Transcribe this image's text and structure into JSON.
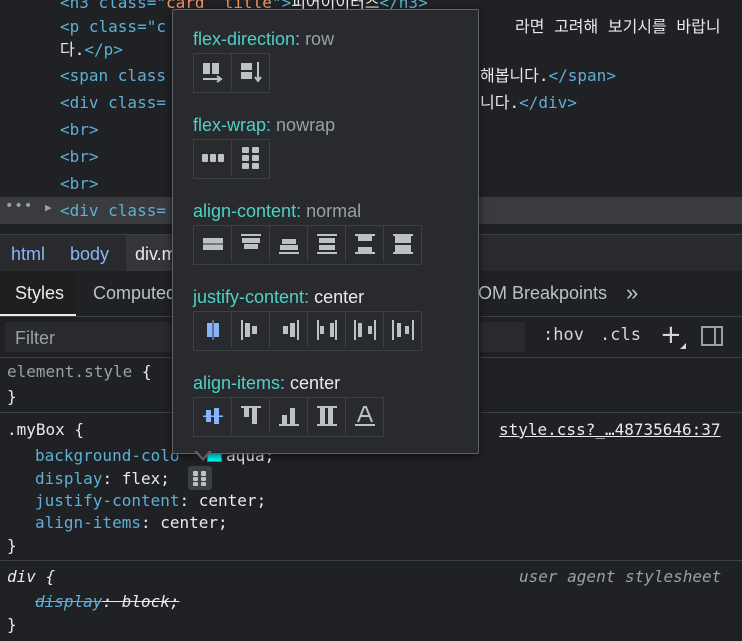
{
  "elements": {
    "lines": [
      {
        "tag_open": "<h3 class=\"",
        "val": "card__title",
        "tag_close": "\">",
        "text": "피어이이터즈",
        "tag_end": "</h3>"
      },
      {
        "tag_open": "<p class=\"c",
        "text": "라면 고려해 보기시를 바랍니"
      },
      {
        "text": "다.",
        "tag_end": "</p>"
      },
      {
        "tag_open": "<span class",
        "text": "해봅니다.",
        "tag_end": "</span>"
      },
      {
        "tag_open": "<div class=",
        "text": "니다.",
        "tag_end": "</div>"
      },
      {
        "tag": "<br>"
      },
      {
        "tag": "<br>"
      },
      {
        "tag": "<br>"
      },
      {
        "tag_open": "<div class="
      }
    ],
    "ellipsis": "•••",
    "expand_arrow": "▶"
  },
  "breadcrumbs": [
    "html",
    "body",
    "div.m"
  ],
  "tabs": {
    "styles": "Styles",
    "computed": "Computed",
    "dom_breakpoints": "OM Breakpoints",
    "more": "»"
  },
  "toolbar": {
    "filter_placeholder": "Filter",
    "hov": ":hov",
    ".cls": ".cls",
    "cls": ".cls",
    "plus": "+"
  },
  "styles": {
    "element_style": {
      "selector": "element.style",
      "open": " {",
      "close": "}"
    },
    "mybox": {
      "selector": ".myBox",
      "open": " {",
      "source": "style.css?_…48735646:37",
      "props": [
        {
          "name": "background-colo",
          "value": "aqua;",
          "swatch": "#00ffff"
        },
        {
          "name": "display",
          "value": "flex;"
        },
        {
          "name": "justify-content",
          "value": "center;"
        },
        {
          "name": "align-items",
          "value": "center;"
        }
      ],
      "close": "}"
    },
    "div_ua": {
      "selector": "div",
      "open": " {",
      "source": "user agent stylesheet",
      "props": [
        {
          "name": "display",
          "value": "block;"
        }
      ],
      "close": "}"
    }
  },
  "popover": {
    "sections": [
      {
        "name": "flex-direction",
        "value": "row",
        "set": false,
        "icons": [
          "flex-direction-row-icon",
          "flex-direction-column-icon"
        ]
      },
      {
        "name": "flex-wrap",
        "value": "nowrap",
        "set": false,
        "icons": [
          "flex-nowrap-icon",
          "flex-wrap-icon"
        ]
      },
      {
        "name": "align-content",
        "value": "normal",
        "set": false,
        "icons": [
          "align-content-center-icon",
          "align-content-flex-start-icon",
          "align-content-flex-end-icon",
          "align-content-space-around-icon",
          "align-content-space-between-icon",
          "align-content-stretch-icon"
        ]
      },
      {
        "name": "justify-content",
        "value": "center",
        "set": true,
        "icons": [
          "justify-content-center-icon",
          "justify-content-flex-start-icon",
          "justify-content-flex-end-icon",
          "justify-content-space-between-icon",
          "justify-content-space-around-icon",
          "justify-content-space-evenly-icon"
        ]
      },
      {
        "name": "align-items",
        "value": "center",
        "set": true,
        "icons": [
          "align-items-center-icon",
          "align-items-flex-start-icon",
          "align-items-flex-end-icon",
          "align-items-stretch-icon",
          "align-items-baseline-icon"
        ]
      }
    ],
    "colors": {
      "label": "#4fd1c5",
      "active_icon": "#8ab4f8",
      "icon": "#bdc1c6"
    }
  }
}
